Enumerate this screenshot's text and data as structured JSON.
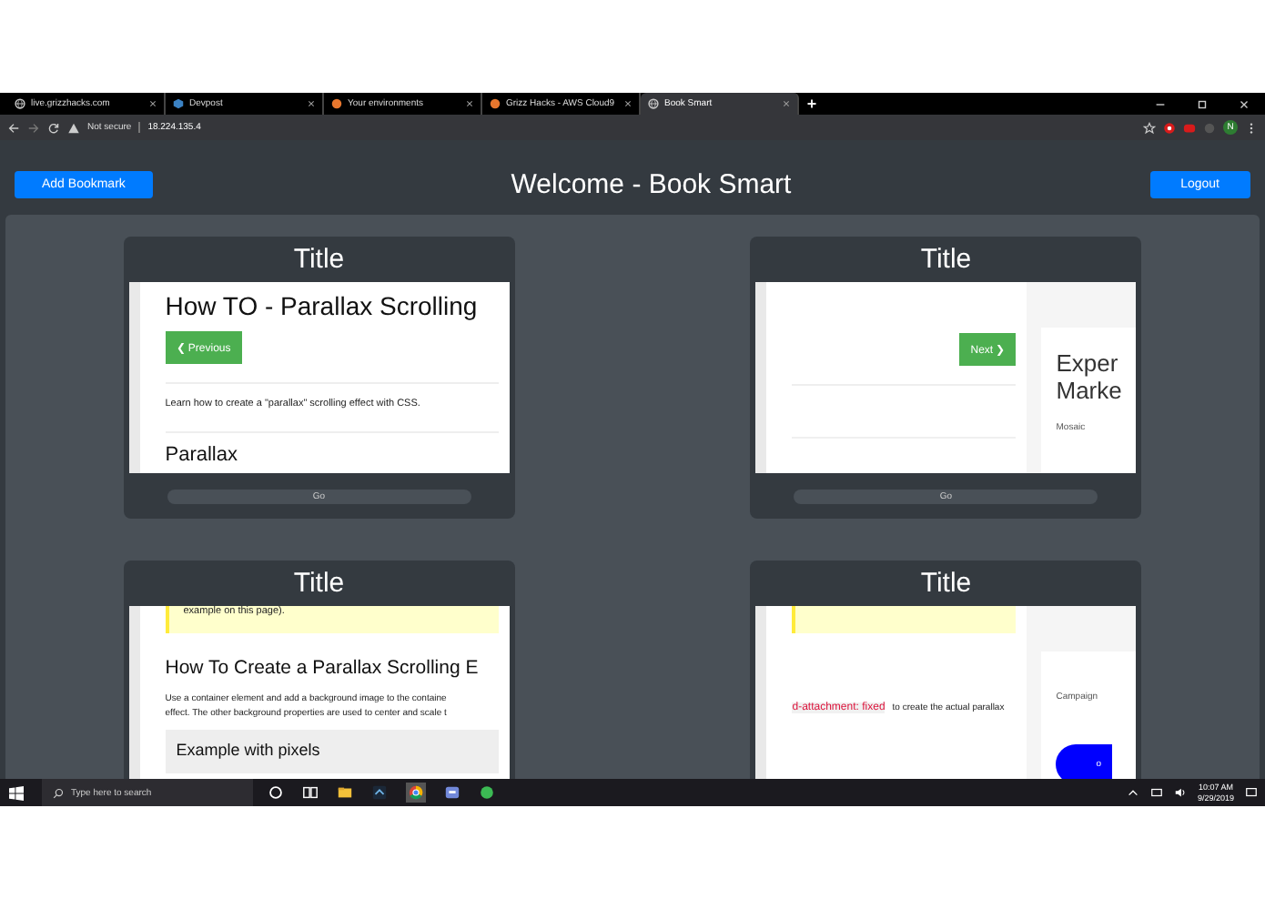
{
  "browser": {
    "tabs": [
      {
        "title": "live.grizzhacks.com",
        "selected": false
      },
      {
        "title": "Devpost",
        "selected": false
      },
      {
        "title": "Your environments",
        "selected": false
      },
      {
        "title": "Grizz Hacks - AWS Cloud9",
        "selected": false
      },
      {
        "title": "Book Smart",
        "selected": true
      }
    ],
    "security": "Not secure",
    "url": "18.224.135.4",
    "profile": "N"
  },
  "header": {
    "add_button": "Add Bookmark",
    "title": "Welcome - Book Smart",
    "logout_button": "Logout"
  },
  "bookmarks": [
    {
      "title": "Title",
      "button": "Go",
      "main": [
        {
          "kind": "heading",
          "text": "How TO - Parallax Scrolling"
        },
        {
          "kind": "prev-button",
          "text": "❮ Previous"
        },
        {
          "kind": "text",
          "text": "Learn how to create a \"parallax\" scrolling effect with CSS."
        },
        {
          "kind": "heading2",
          "text": "Parallax"
        }
      ]
    },
    {
      "title": "Title",
      "button": "Go",
      "main": [
        {
          "kind": "spacer"
        },
        {
          "kind": "next-button",
          "text": "Next ❯"
        },
        {
          "kind": "spacer"
        }
      ],
      "side": [
        {
          "kind": "side-heading",
          "text": "Exper"
        },
        {
          "kind": "side-heading",
          "text": "Marke"
        },
        {
          "kind": "side-text",
          "text": "Mosaic"
        }
      ]
    },
    {
      "title": "Title",
      "main": [
        {
          "kind": "note",
          "text": "example on this page)."
        },
        {
          "kind": "subheading",
          "text": "How To Create a Parallax Scrolling E"
        },
        {
          "kind": "small-text",
          "text": "Use a container element and add a background image to the containe"
        },
        {
          "kind": "small-text",
          "text": "effect. The other background properties are used to center and scale t"
        },
        {
          "kind": "example",
          "text": "Example with pixels"
        }
      ]
    },
    {
      "title": "Title",
      "main": [
        {
          "kind": "note-bar"
        },
        {
          "kind": "code-text",
          "code": "d-attachment: fixed",
          "text": "to create the actual parallax"
        }
      ],
      "side": [
        {
          "kind": "side-text",
          "text": "Campaign"
        },
        {
          "kind": "pill",
          "text": "o"
        }
      ]
    }
  ],
  "taskbar": {
    "search_placeholder": "Type here to search",
    "time": "10:07 AM",
    "date": "9/29/2019"
  }
}
